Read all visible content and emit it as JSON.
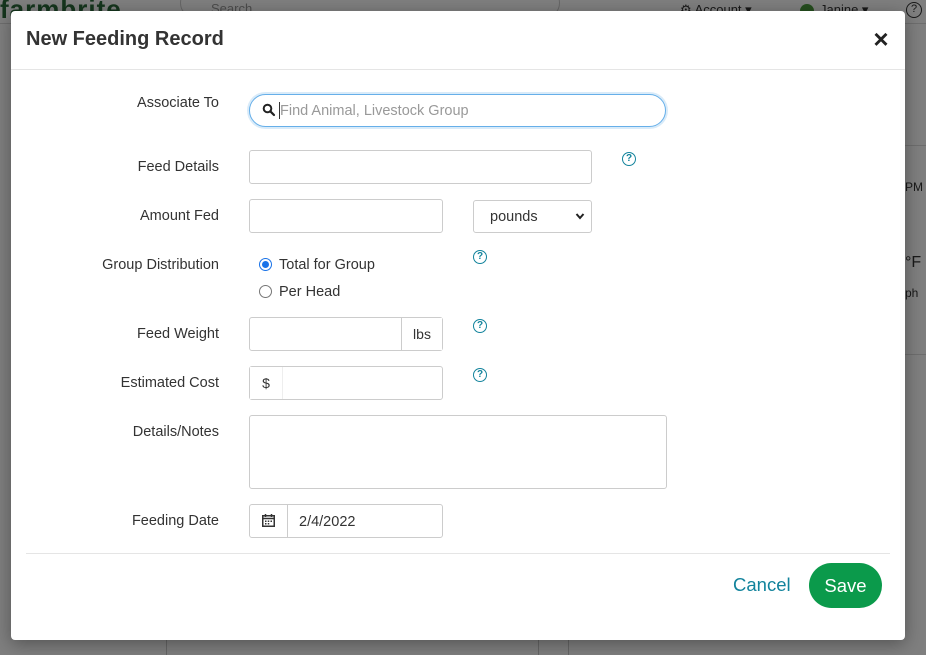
{
  "background": {
    "logo": "farmbrite",
    "search_placeholder": "Search",
    "account_label": "Account",
    "user_label": "Janine",
    "help": "?",
    "right_panel": [
      "PM",
      "°F",
      "ph"
    ]
  },
  "modal": {
    "title": "New Feeding Record",
    "close": "×"
  },
  "form": {
    "associate_to": {
      "label": "Associate To",
      "placeholder": "Find Animal, Livestock Group"
    },
    "feed_details": {
      "label": "Feed Details",
      "value": ""
    },
    "amount_fed": {
      "label": "Amount Fed",
      "value": "",
      "unit_selected": "pounds"
    },
    "group_distribution": {
      "label": "Group Distribution",
      "options": [
        {
          "label": "Total for Group",
          "checked": true
        },
        {
          "label": "Per Head",
          "checked": false
        }
      ]
    },
    "feed_weight": {
      "label": "Feed Weight",
      "value": "",
      "unit": "lbs"
    },
    "estimated_cost": {
      "label": "Estimated Cost",
      "prefix": "$",
      "value": ""
    },
    "details_notes": {
      "label": "Details/Notes",
      "value": ""
    },
    "feeding_date": {
      "label": "Feeding Date",
      "value": "2/4/2022"
    }
  },
  "footer": {
    "cancel_label": "Cancel",
    "save_label": "Save"
  },
  "colors": {
    "accent": "#12839c",
    "save": "#0b9a4b",
    "focus": "#66afe9",
    "radio": "#1a73e8"
  }
}
